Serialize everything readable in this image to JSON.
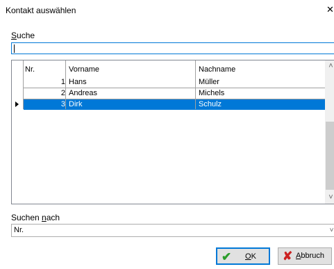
{
  "window": {
    "title": "Kontakt auswählen",
    "close_glyph": "✕"
  },
  "search": {
    "label_key": "S",
    "label_rest": "uche",
    "value": ""
  },
  "grid": {
    "columns": [
      "Nr.",
      "Vorname",
      "Nachname"
    ],
    "rows": [
      {
        "nr": "1",
        "vorname": "Hans",
        "nachname": "Müller"
      },
      {
        "nr": "2",
        "vorname": "Andreas",
        "nachname": "Michels"
      },
      {
        "nr": "3",
        "vorname": "Dirk",
        "nachname": "Schulz"
      }
    ],
    "selected_row": 3,
    "scroll_up": "˄",
    "scroll_down": "˅"
  },
  "search_by": {
    "label_pre": "Suchen ",
    "label_key": "n",
    "label_post": "ach",
    "value": "Nr.",
    "arrow": "˅"
  },
  "buttons": {
    "ok": {
      "key": "O",
      "rest": "K",
      "icon": "✔",
      "icon_color": "#2a9d2a"
    },
    "cancel": {
      "key": "A",
      "rest": "bbruch",
      "icon": "✘",
      "icon_color": "#cc2222"
    }
  },
  "colors": {
    "selection": "#0078d7",
    "focus_border": "#0078d7"
  }
}
